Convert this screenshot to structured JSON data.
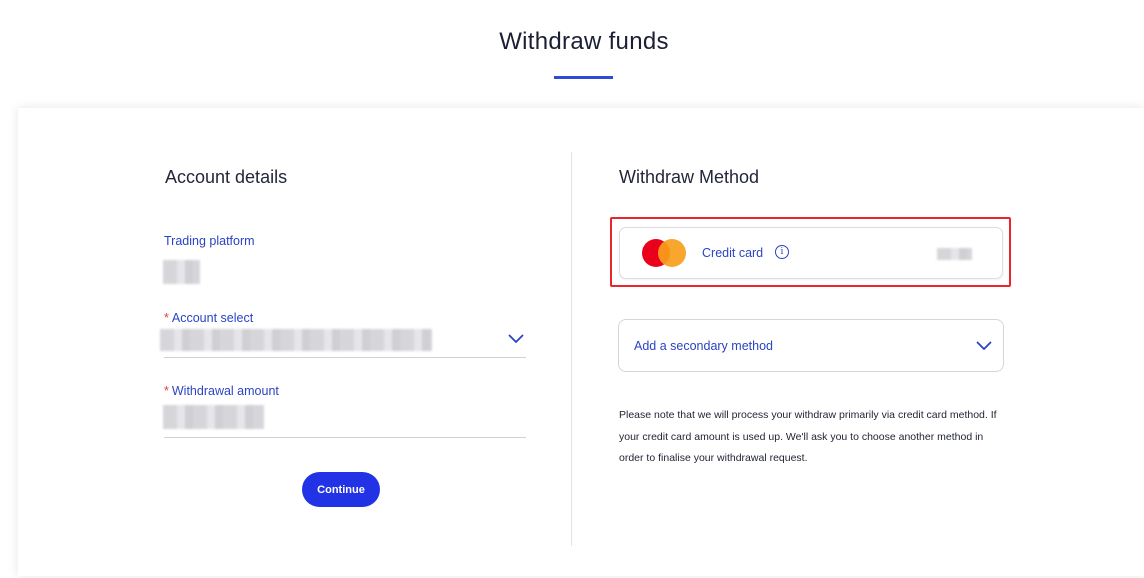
{
  "page": {
    "title": "Withdraw funds"
  },
  "account_details": {
    "heading": "Account details",
    "trading_platform_label": "Trading platform",
    "account_select_label": "Account select",
    "withdrawal_amount_label": "Withdrawal amount",
    "required_marker": "*",
    "continue_label": "Continue"
  },
  "withdraw_method": {
    "heading": "Withdraw Method",
    "primary_method_label": "Credit card",
    "info_glyph": "i",
    "secondary_placeholder": "Add a secondary method",
    "note": "Please note that we will process your withdraw primarily via credit card method. If your credit card amount is used up. We'll ask you to choose another method in order to finalise your withdrawal request."
  },
  "colors": {
    "accent": "#2f4bd6",
    "link_blue": "#2a44c4",
    "button_blue": "#2233e6",
    "highlight_red": "#e8262b",
    "mastercard_red": "#eb001b",
    "mastercard_orange": "#f79e1b"
  },
  "icons": {
    "primary_method": "mastercard-icon",
    "info": "info-icon",
    "dropdown": "chevron-down-icon"
  }
}
